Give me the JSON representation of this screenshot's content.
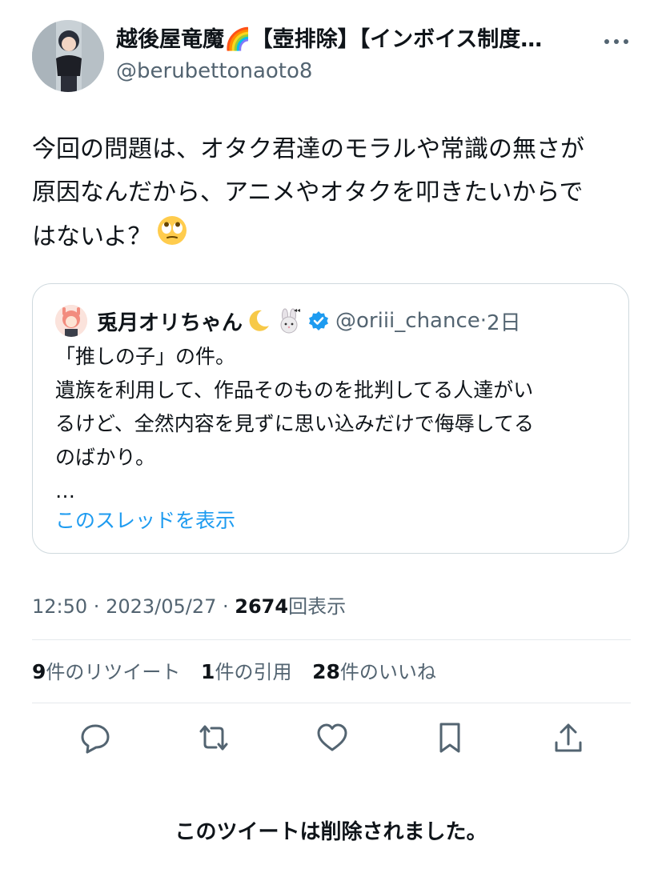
{
  "author": {
    "display_name": "越後屋竜魔🌈【壺排除】【インボイス制度…",
    "handle": "@berubettonaoto8"
  },
  "tweet": {
    "lines": [
      "今回の問題は、オタク君達のモラルや常識の無さが",
      "原因なんだから、アニメやオタクを叩きたいからで",
      "はないよ？"
    ]
  },
  "quote": {
    "name": "兎月オリちゃん",
    "handle": "@oriii_chance",
    "separator": "·",
    "time": "2日",
    "lines": [
      "「推しの子」の件。",
      "遺族を利用して、作品そのものを批判してる人達がい",
      "るけど、全然内容を見ずに思い込みだけで侮辱してる",
      "のばかり。",
      "…"
    ],
    "show_thread": "このスレッドを表示"
  },
  "meta": {
    "time": "12:50",
    "sep1": " · ",
    "date": "2023/05/27",
    "sep2": " · ",
    "views_count": "2674",
    "views_label": "回表示"
  },
  "stats": {
    "retweets_count": "9",
    "retweets_label": "件のリツイート",
    "quotes_count": "1",
    "quotes_label": "件の引用",
    "likes_count": "28",
    "likes_label": "件のいいね"
  },
  "deleted_notice": "このツイートは削除されました。",
  "colors": {
    "text": "#0f1419",
    "secondary": "#536471",
    "link": "#1d9bf0",
    "border": "#cfd9de",
    "verified": "#1d9bf0"
  },
  "icons": [
    "more-icon",
    "rainbow-icon",
    "moon-icon",
    "rabbit-icon",
    "verified-badge-icon",
    "eye-roll-emoji-icon",
    "reply-icon",
    "retweet-icon",
    "like-icon",
    "bookmark-icon",
    "share-icon"
  ]
}
